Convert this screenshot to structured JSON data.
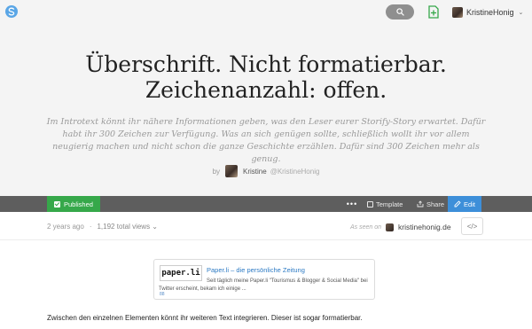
{
  "header": {
    "logo_icon": "storify-logo-icon",
    "search_icon": "search-icon",
    "new_story_icon": "new-story-icon",
    "user_name": "KristineHonig",
    "caret": "⌄"
  },
  "story": {
    "title_line1": "Überschrift. Nicht formatierbar.",
    "title_line2": "Zeichenanzahl: offen.",
    "intro": "Im Introtext könnt ihr nähere Informationen geben, was den Leser eurer Storify-Story erwartet. Dafür habt ihr 300 Zeichen zur Verfügung. Was an sich genügen sollte, schließlich wollt ihr vor allem neugierig machen und nicht schon die ganze Geschichte erzählen. Dafür sind 300 Zeichen mehr als genug.",
    "by_label": "by",
    "author_name": "Kristine",
    "author_handle": "@KristineHonig"
  },
  "actionbar": {
    "published_label": "Published",
    "more_label": "•••",
    "template_label": "Template",
    "share_label": "Share",
    "edit_label": "Edit"
  },
  "meta": {
    "age": "2 years ago",
    "separator": "·",
    "views": "1,192 total views ⌄",
    "as_seen_on": "As seen on",
    "site": "kristinehonig.de",
    "embed_label": "</>"
  },
  "card": {
    "thumb_text": "paper.li",
    "title": "Paper.li – die persönliche Zeitung",
    "description": "Seit täglich meine Paper.li \"Tourismus & Blogger & Social Media\" bei Twitter erscheint, bekam ich einige ...",
    "mark": "88"
  },
  "paragraph": "Zwischen den einzelnen Elementen könnt ihr weiteren Text integrieren. Dieser ist sogar formatierbar.",
  "colors": {
    "published": "#36a84a",
    "edit": "#3d8fd9",
    "actionbar": "#5e5e5e",
    "link": "#2e7bc4"
  }
}
